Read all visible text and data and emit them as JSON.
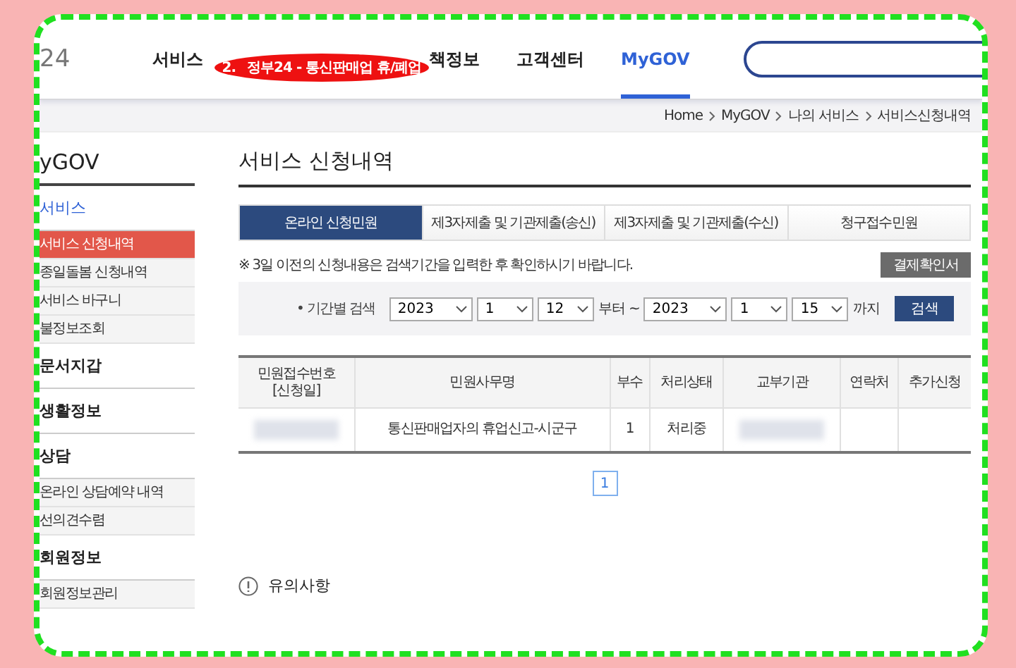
{
  "header": {
    "logo": "24",
    "nav": [
      {
        "label": "서비스",
        "selected": false
      },
      {
        "label": "책정보",
        "selected": false
      },
      {
        "label": "고객센터",
        "selected": false
      },
      {
        "label": "MyGOV",
        "selected": true
      }
    ],
    "annotation": {
      "number": "2.",
      "text": "정부24 - 통신판매업 휴/폐업"
    }
  },
  "breadcrumb": [
    "Home",
    "MyGOV",
    "나의 서비스",
    "서비스신청내역"
  ],
  "sidebar": {
    "title": "yGOV",
    "groups": [
      {
        "label": "서비스",
        "expanded": true,
        "items": [
          {
            "label": "서비스 신청내역",
            "selected": true
          },
          {
            "label": "종일돌봄 신청내역",
            "selected": false
          },
          {
            "label": "서비스 바구니",
            "selected": false
          },
          {
            "label": "불정보조회",
            "selected": false
          }
        ]
      },
      {
        "label": "문서지갑",
        "expanded": false
      },
      {
        "label": "생활정보",
        "expanded": false
      },
      {
        "label": "상담",
        "expanded": true,
        "items": [
          {
            "label": "온라인 상담예약 내역",
            "selected": false
          },
          {
            "label": "선의견수렴",
            "selected": false
          }
        ]
      },
      {
        "label": "회원정보",
        "expanded": true,
        "items": [
          {
            "label": "회원정보관리",
            "selected": false
          }
        ]
      }
    ]
  },
  "content": {
    "title": "서비스 신청내역",
    "tabs": [
      {
        "label": "온라인 신청민원",
        "selected": true
      },
      {
        "label": "제3자제출 및 기관제출(송신)",
        "selected": false
      },
      {
        "label": "제3자제출 및 기관제출(수신)",
        "selected": false
      },
      {
        "label": "청구접수민원",
        "selected": false
      }
    ],
    "note": "※ 3일 이전의 신청내용은 검색기간을 입력한 후 확인하시기 바랍니다.",
    "receipt_button": "결제확인서",
    "search": {
      "label": "• 기간별 검색",
      "from": [
        "2023",
        "1",
        "12"
      ],
      "from_suffix": "부터 ~",
      "to": [
        "2023",
        "1",
        "15"
      ],
      "to_suffix": "까지",
      "button": "검색"
    },
    "table": {
      "columns": [
        "민원접수번호\n[신청일]",
        "민원사무명",
        "부수",
        "처리상태",
        "교부기관",
        "연락처",
        "추가신청"
      ],
      "rows": [
        [
          {
            "redacted": true
          },
          {
            "text": "통신판매업자의 휴업신고-시군구"
          },
          {
            "text": "1"
          },
          {
            "text": "처리중"
          },
          {
            "redacted": true
          },
          null,
          null
        ]
      ]
    },
    "pages": [
      {
        "label": "1",
        "selected": true
      }
    ],
    "notice": "유의사항"
  }
}
